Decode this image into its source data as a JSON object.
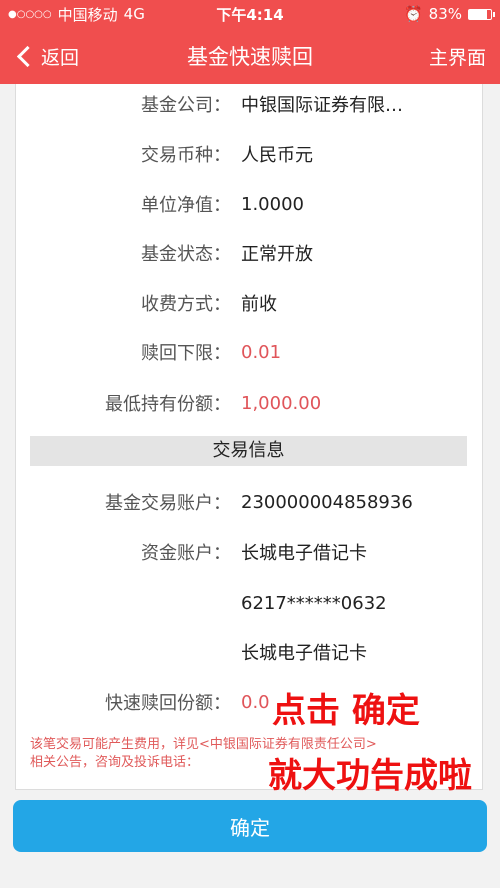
{
  "status_bar": {
    "carrier": "中国移动",
    "network": "4G",
    "time": "下午4:14",
    "battery": "83%",
    "battery_level": 0.83
  },
  "nav": {
    "back_label": "返回",
    "title": "基金快速赎回",
    "home_label": "主界面"
  },
  "fund_info": {
    "company_label": "基金公司：",
    "company_value": "中银国际证券有限…",
    "currency_label": "交易币种：",
    "currency_value": "人民币元",
    "nav_label": "单位净值：",
    "nav_value": "1.0000",
    "status_label": "基金状态：",
    "status_value": "正常开放",
    "fee_label": "收费方式：",
    "fee_value": "前收",
    "min_redeem_label": "赎回下限：",
    "min_redeem_value": "0.01",
    "min_hold_label": "最低持有份额：",
    "min_hold_value": "1,000.00"
  },
  "trade_section_title": "交易信息",
  "trade_info": {
    "account_label": "基金交易账户：",
    "account_value": "230000004858936",
    "fund_account_label": "资金账户：",
    "fund_account_name": "长城电子借记卡",
    "card_number": "6217******0632",
    "card_name": "长城电子借记卡",
    "quick_redeem_label": "快速赎回份额：",
    "quick_redeem_value": "0.0"
  },
  "disclaimer_line1": "该笔交易可能产生费用，详见<中银国际证券有限责任公司>",
  "disclaimer_line2": "相关公告，咨询及投诉电话：",
  "overlay_text_1": "点击 确定",
  "overlay_text_2": "就大功告成啦",
  "confirm_label": "确定"
}
